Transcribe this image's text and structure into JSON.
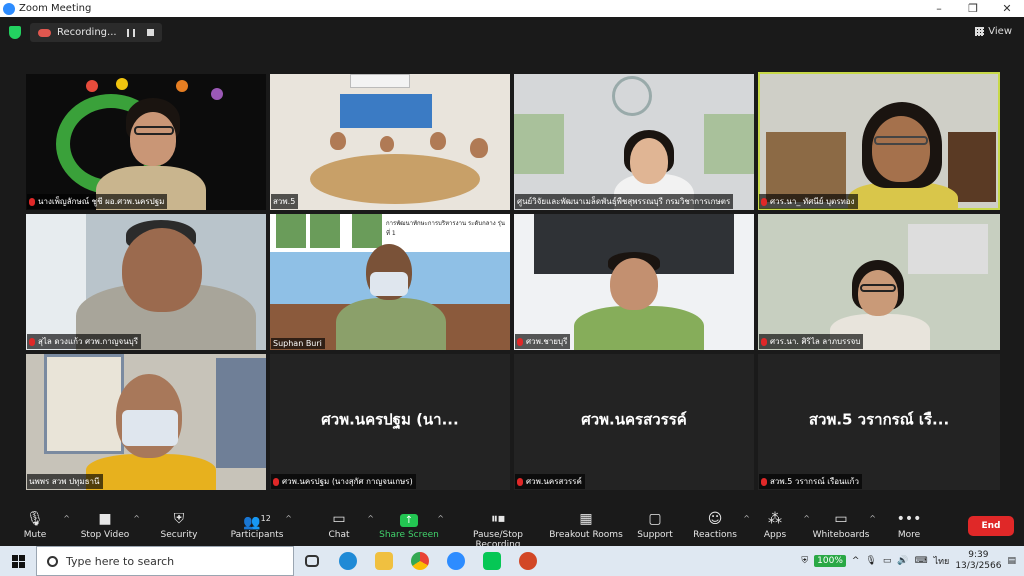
{
  "window": {
    "title": "Zoom Meeting",
    "controls": [
      "–",
      "❐",
      "✕"
    ]
  },
  "topbar": {
    "recording_label": "Recording...",
    "view_label": "View"
  },
  "tiles": [
    {
      "name": "นางเพ็ญลักษณ์ ชูชี ผอ.ศวพ.นครปฐม",
      "muted": true
    },
    {
      "name": "สวพ.5",
      "muted": false
    },
    {
      "name": "ศูนย์วิจัยและพัฒนาเมล็ดพันธุ์พืชสุพรรณบุรี กรมวิชาการเกษตร",
      "muted": false
    },
    {
      "name": "ศวร.นา_ ทัศนีย์ บุตรทอง",
      "muted": true
    },
    {
      "name": "สุไล ดวงแก้ว ศวพ.กาญจนบุรี",
      "muted": true
    },
    {
      "name": "Suphan Buri",
      "muted": false
    },
    {
      "name": "ศวพ.ชายบุรี",
      "muted": true
    },
    {
      "name": "ศวร.นา. ศิริไล ลาภบรรจบ",
      "muted": true
    },
    {
      "name": "นพพร สวพ ปทุมธานี",
      "muted": true
    },
    {
      "name": "ศวพ.นครปฐม (นางสุกัศ กาญจนเกษร)",
      "muted": true,
      "display_name": "ศวพ.นครปฐม (นา..."
    },
    {
      "name": "ศวพ.นครสวรรค์",
      "muted": true,
      "display_name": "ศวพ.นครสวรรค์"
    },
    {
      "name": "สวพ.5 วรากรณ์ เรือนแก้ว",
      "muted": true,
      "display_name": "สวพ.5 วรากรณ์ เรื..."
    }
  ],
  "slide_header": "การพัฒนาทักษะการบริหารงาน ระดับกลาง รุ่นที่ 1",
  "toolbar": {
    "mute": "Mute",
    "stop_video": "Stop Video",
    "security": "Security",
    "participants": "Participants",
    "participants_count": "12",
    "chat": "Chat",
    "share_screen": "Share Screen",
    "pause_stop_recording": "Pause/Stop Recording",
    "breakout_rooms": "Breakout Rooms",
    "support": "Support",
    "reactions": "Reactions",
    "apps": "Apps",
    "whiteboards": "Whiteboards",
    "more": "More",
    "end": "End"
  },
  "taskbar": {
    "search_placeholder": "Type here to search",
    "battery": "100%",
    "lang": "ไทย",
    "time": "9:39",
    "date": "13/3/2566"
  },
  "colors": {
    "accent_green": "#41d26b",
    "end_red": "#e02828",
    "active_border": "#c8d94a",
    "zoom_blue": "#2D8CFF"
  }
}
